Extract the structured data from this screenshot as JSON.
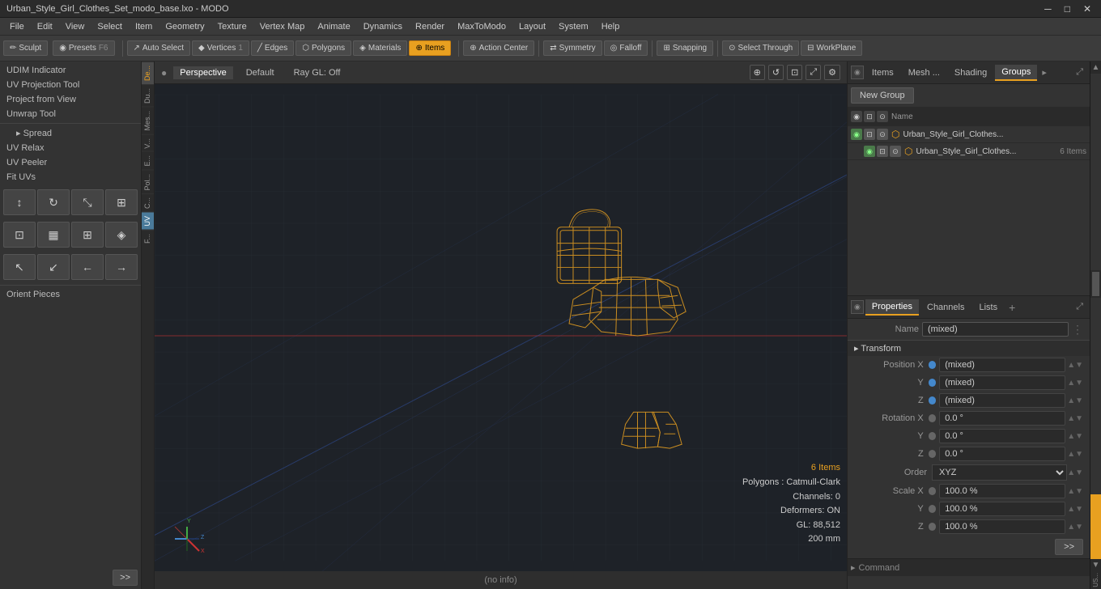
{
  "titlebar": {
    "title": "Urban_Style_Girl_Clothes_Set_modo_base.lxo - MODO",
    "minimize": "─",
    "maximize": "□",
    "close": "✕"
  },
  "menubar": {
    "items": [
      "File",
      "Edit",
      "View",
      "Select",
      "Item",
      "Geometry",
      "Texture",
      "Vertex Map",
      "Animate",
      "Dynamics",
      "Render",
      "MaxToModo",
      "Layout",
      "System",
      "Help"
    ]
  },
  "toolbar": {
    "sculpt_label": "Sculpt",
    "presets_label": "Presets",
    "presets_shortcut": "F6",
    "auto_select": "Auto Select",
    "vertices": "Vertices",
    "vertices_num": "1",
    "edges": "Edges",
    "polygons": "Polygons",
    "materials": "Materials",
    "items": "Items",
    "action_center": "Action Center",
    "symmetry": "Symmetry",
    "falloff": "Falloff",
    "snapping": "Snapping",
    "select_through": "Select Through",
    "workplane": "WorkPlane"
  },
  "left_panel": {
    "tools": [
      "UDIM Indicator",
      "UV Projection Tool",
      "Project from View",
      "Unwrap Tool",
      "Spread",
      "UV Relax",
      "UV Peeler",
      "Fit UVs",
      "Orient Pieces"
    ],
    "udim_indicator": "UDIM Indicator",
    "uv_projection_tool": "UV Projection Tool",
    "project_from_view": "Project from View",
    "unwrap_tool": "Unwrap Tool",
    "spread": "Spread",
    "uv_relax": "UV Relax",
    "uv_peeler": "UV Peeler",
    "fit_uvs": "Fit UVs",
    "orient_pieces": "Orient Pieces",
    "expand_btn": ">>"
  },
  "side_tabs": {
    "items": [
      "De...",
      "Du...",
      "Mes...",
      "V...",
      "E...",
      "Pol...",
      "C...",
      "UV",
      "F..."
    ]
  },
  "viewport": {
    "perspective_tab": "Perspective",
    "default_tab": "Default",
    "ray_gl": "Ray GL: Off",
    "items_count": "6 Items",
    "polygons": "Polygons : Catmull-Clark",
    "channels": "Channels: 0",
    "deformers": "Deformers: ON",
    "gl_count": "GL: 88,512",
    "size": "200 mm",
    "no_info": "(no info)"
  },
  "right_panel": {
    "tabs_top": [
      "Items",
      "Mesh ...",
      "Shading",
      "Groups"
    ],
    "active_top_tab": "Groups",
    "new_group_btn": "New Group",
    "item_cols": {
      "name": "Name"
    },
    "items": [
      {
        "name": "Urban_Style_Girl_Clothes...",
        "count": "6 Items",
        "has_eye": true,
        "indent": 0
      }
    ],
    "tabs_bottom": [
      "Properties",
      "Channels",
      "Lists"
    ],
    "add_btn": "+",
    "name_label": "Name",
    "name_value": "(mixed)",
    "transform_section": "Transform",
    "position_x_label": "Position X",
    "position_x_value": "(mixed)",
    "position_y_label": "Y",
    "position_y_value": "(mixed)",
    "position_z_label": "Z",
    "position_z_value": "(mixed)",
    "rotation_x_label": "Rotation X",
    "rotation_x_value": "0.0 °",
    "rotation_y_label": "Y",
    "rotation_y_value": "0.0 °",
    "rotation_z_label": "Z",
    "rotation_z_value": "0.0 °",
    "order_label": "Order",
    "order_value": "XYZ",
    "scale_x_label": "Scale X",
    "scale_x_value": "100.0 %",
    "scale_y_label": "Y",
    "scale_y_value": "100.0 %",
    "scale_z_label": "Z",
    "scale_z_value": "100.0 %",
    "bottom_btn": ">>",
    "command_label": "Command",
    "command_placeholder": ""
  },
  "colors": {
    "accent": "#e8a020",
    "bg_dark": "#1e2228",
    "bg_mid": "#2e2e2e",
    "bg_light": "#3a3a3a",
    "text_normal": "#cccccc",
    "text_dim": "#888888",
    "item_orange": "#e8a020"
  }
}
